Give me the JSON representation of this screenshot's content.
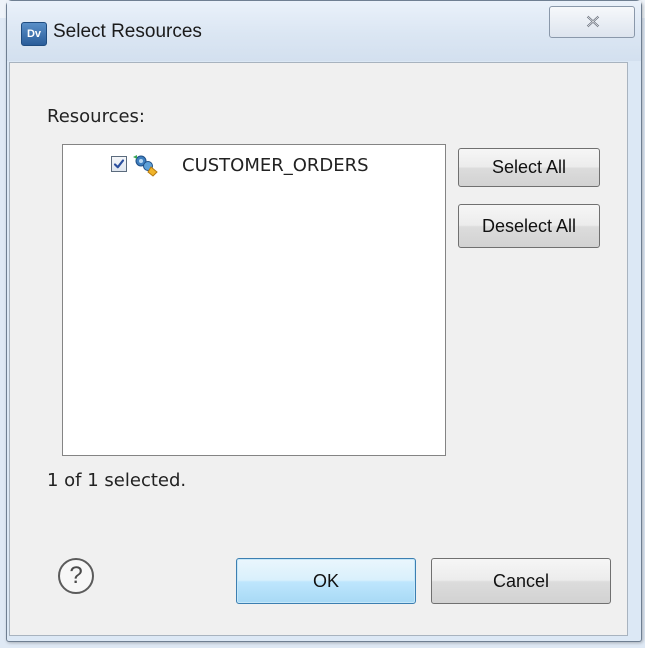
{
  "window": {
    "icon_text": "Dv",
    "title": "Select Resources"
  },
  "dialog": {
    "resources_label": "Resources:",
    "resources": [
      {
        "label": "CUSTOMER_ORDERS",
        "checked": true
      }
    ],
    "select_all_label": "Select All",
    "deselect_all_label": "Deselect All",
    "status_text": "1 of 1 selected.",
    "help_glyph": "?",
    "ok_label": "OK",
    "cancel_label": "Cancel"
  },
  "colors": {
    "ok_button_border": "#3c7fb1",
    "title_bar": "#dce8f5",
    "client_bg": "#f0f0f0"
  }
}
